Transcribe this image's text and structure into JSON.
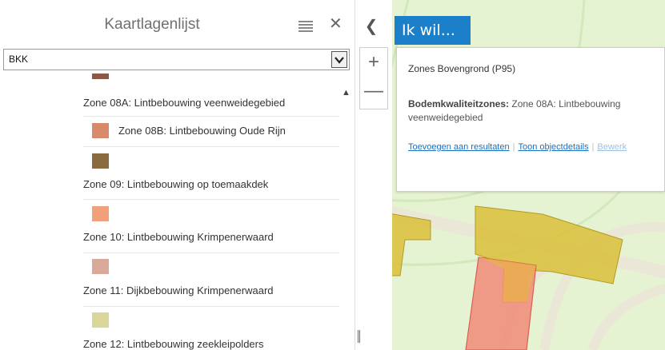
{
  "panel": {
    "title": "Kaartlagenlijst",
    "layer_select": {
      "value": "BKK"
    }
  },
  "legend": {
    "items": [
      {
        "label": "Zone 08A: Lintbebouwing veenweidegebied",
        "color": "#8a5a46"
      },
      {
        "label": "Zone 08B: Lintbebouwing Oude Rijn",
        "color": "#d98a6b"
      },
      {
        "label": "Zone 09: Lintbebouwing op toemaakdek",
        "color": "#8a6b3f"
      },
      {
        "label": "Zone 10: Lintbebouwing Krimpenerwaard",
        "color": "#f2a07a"
      },
      {
        "label": "Zone 11: Dijkbebouwing Krimpenerwaard",
        "color": "#d9a99a"
      },
      {
        "label": "Zone 12: Lintbebouwing zeekleipolders",
        "color": "#d9d79a"
      }
    ]
  },
  "map": {
    "back_icon": "chevron-left-icon",
    "zoom_in": "+",
    "zoom_out": "—",
    "ik_wil": "Ik wil..."
  },
  "popup": {
    "title": "Zones Bovengrond (P95)",
    "key": "Bodemkwaliteitzones:",
    "value": " Zone 08A: Lintbebouwing veenweidegebied",
    "actions": {
      "add": "Toevoegen aan resultaten",
      "details": "Toon objectdetails",
      "edit": "Bewerk"
    }
  }
}
